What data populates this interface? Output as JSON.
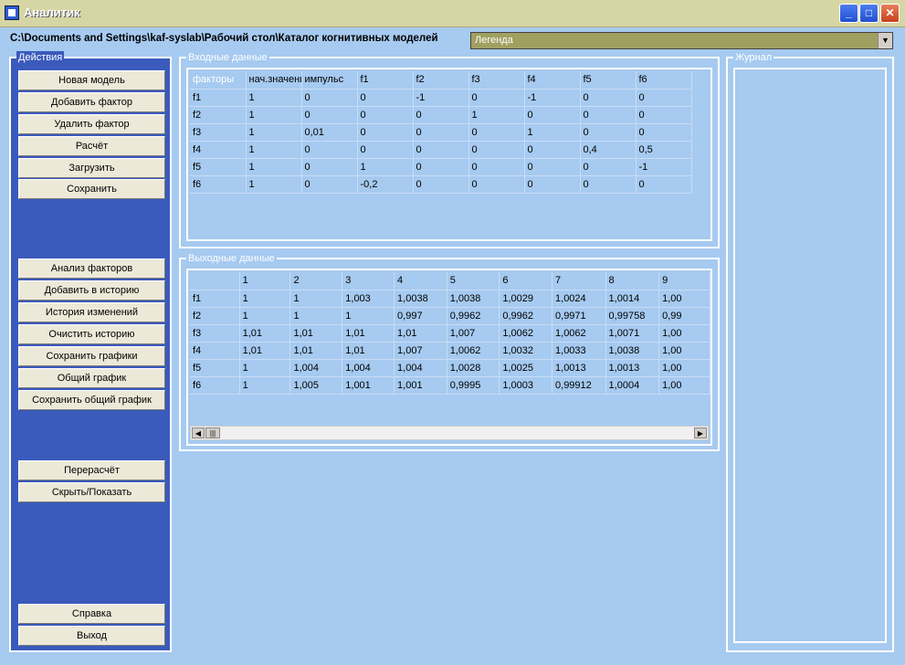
{
  "window": {
    "title": "Аналитик",
    "min_glyph": "_",
    "max_glyph": "□",
    "close_glyph": "✕"
  },
  "path": "C:\\Documents and Settings\\kaf-syslab\\Рабочий стол\\Каталог когнитивных моделей",
  "legend_select": {
    "value": "Легенда",
    "arrow": "▼"
  },
  "actions": {
    "label": "Действия",
    "buttons": [
      "Новая модель",
      "Добавить фактор",
      "Удалить фактор",
      "Расчёт",
      "Загрузить",
      "Сохранить",
      "Анализ факторов",
      "Добавить в историю",
      "История изменений",
      "Очистить историю",
      "Сохранить графики",
      "Общий график",
      "Сохранить общий график",
      "Перерасчёт",
      "Скрыть/Показать",
      "Справка",
      "Выход"
    ]
  },
  "input": {
    "label": "Входные данные",
    "header": [
      "факторы",
      "нач.значения",
      "импульс",
      "f1",
      "f2",
      "f3",
      "f4",
      "f5",
      "f6"
    ],
    "rows": [
      [
        "f1",
        "1",
        "0",
        "0",
        "-1",
        "0",
        "-1",
        "0",
        "0"
      ],
      [
        "f2",
        "1",
        "0",
        "0",
        "0",
        "1",
        "0",
        "0",
        "0"
      ],
      [
        "f3",
        "1",
        "0,01",
        "0",
        "0",
        "0",
        "1",
        "0",
        "0"
      ],
      [
        "f4",
        "1",
        "0",
        "0",
        "0",
        "0",
        "0",
        "0,4",
        "0,5"
      ],
      [
        "f5",
        "1",
        "0",
        "1",
        "0",
        "0",
        "0",
        "0",
        "-1"
      ],
      [
        "f6",
        "1",
        "0",
        "-0,2",
        "0",
        "0",
        "0",
        "0",
        "0"
      ]
    ]
  },
  "output": {
    "label": "Выходные данные",
    "header": [
      "",
      "1",
      "2",
      "3",
      "4",
      "5",
      "6",
      "7",
      "8",
      "9"
    ],
    "rows": [
      [
        "f1",
        "1",
        "1",
        "1,003",
        "1,0038",
        "1,0038",
        "1,0029",
        "1,0024",
        "1,0014",
        "1,00"
      ],
      [
        "f2",
        "1",
        "1",
        "1",
        "0,997",
        "0,9962",
        "0,9962",
        "0,9971",
        "0,99758",
        "0,99"
      ],
      [
        "f3",
        "1,01",
        "1,01",
        "1,01",
        "1,01",
        "1,007",
        "1,0062",
        "1,0062",
        "1,0071",
        "1,00"
      ],
      [
        "f4",
        "1,01",
        "1,01",
        "1,01",
        "1,007",
        "1,0062",
        "1,0032",
        "1,0033",
        "1,0038",
        "1,00"
      ],
      [
        "f5",
        "1",
        "1,004",
        "1,004",
        "1,004",
        "1,0028",
        "1,0025",
        "1,0013",
        "1,0013",
        "1,00"
      ],
      [
        "f6",
        "1",
        "1,005",
        "1,001",
        "1,001",
        "0,9995",
        "1,0003",
        "0,99912",
        "1,0004",
        "1,00"
      ]
    ],
    "scroll_left": "◀",
    "scroll_thumb": "|||",
    "scroll_right": "▶"
  },
  "journal": {
    "label": "Журнал"
  }
}
